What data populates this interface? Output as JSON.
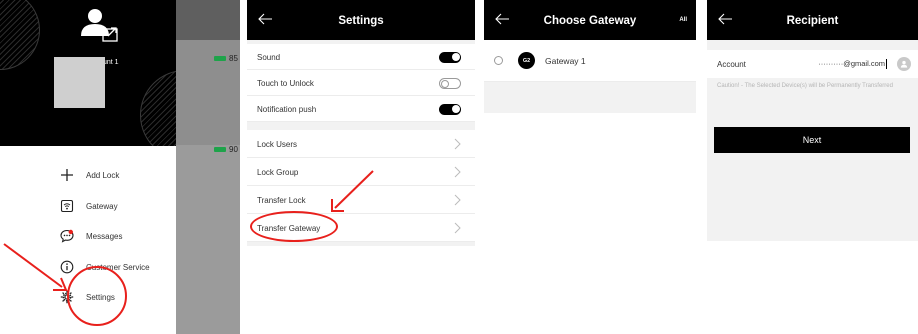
{
  "drawer": {
    "account_label": "unt 1",
    "battery_label_1": "85",
    "battery_label_2": "90",
    "menu": [
      {
        "label": "Add Lock",
        "icon": "plus-icon"
      },
      {
        "label": "Gateway",
        "icon": "gateway-icon"
      },
      {
        "label": "Messages",
        "icon": "message-icon"
      },
      {
        "label": "Customer Service",
        "icon": "info-icon"
      },
      {
        "label": "Settings",
        "icon": "gear-icon"
      }
    ]
  },
  "settings": {
    "title": "Settings",
    "rows": [
      {
        "label": "Sound",
        "control": "toggle",
        "on": true
      },
      {
        "label": "Touch to Unlock",
        "control": "toggle",
        "on": false
      },
      {
        "label": "Notification push",
        "control": "toggle",
        "on": true
      },
      {
        "label": "Lock Users",
        "control": "chevron"
      },
      {
        "label": "Lock Group",
        "control": "chevron"
      },
      {
        "label": "Transfer Lock",
        "control": "chevron"
      },
      {
        "label": "Transfer Gateway",
        "control": "chevron"
      }
    ]
  },
  "choose_gateway": {
    "title": "Choose Gateway",
    "all_label": "All",
    "gateway_badge": "G2",
    "gateway_name": "Gateway 1"
  },
  "recipient": {
    "title": "Recipient",
    "account_label": "Account",
    "account_value": "··········@gmail.com",
    "caution": "Caution! - The Selected Device(s) will be Permanently Transferred",
    "next_label": "Next"
  },
  "colors": {
    "bar": "#000000",
    "annotation_red": "#e8201c",
    "battery_green": "#1ea34a",
    "section_gray": "#f2f2f2"
  }
}
